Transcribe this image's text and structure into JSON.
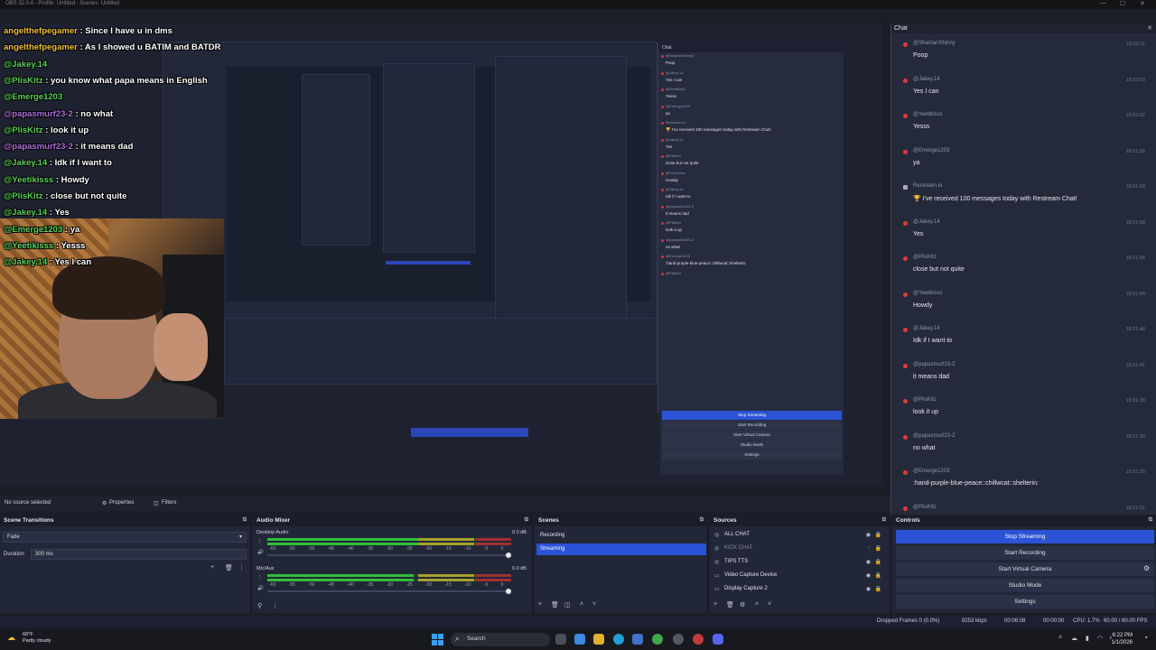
{
  "titlebar": {
    "title": "OBS 32.0.4 - Profile: Untitled - Scenes: Untitled"
  },
  "overlay_chat": [
    {
      "name": "angelthefpegamer",
      "msg": " : Since I have u in dms",
      "color": "#f0c040"
    },
    {
      "name": "angelthefpegamer",
      "msg": " : As I showed u BATIM and BATDR",
      "color": "#f0c040"
    },
    {
      "name": "@Jakey.14",
      "msg": "",
      "color": "#5ad25a"
    },
    {
      "name": "@PlisKitz",
      "msg": " : you know what papa means in English",
      "color": "#5ad25a"
    },
    {
      "name": "@Emerge1203",
      "msg": "",
      "color": "#5ad25a"
    },
    {
      "name": "@papasmurf23-2",
      "msg": " : no what",
      "color": "#b070e0"
    },
    {
      "name": "@PlisKitz",
      "msg": " : look it up",
      "color": "#5ad25a"
    },
    {
      "name": "@papasmurf23-2",
      "msg": " : it means dad",
      "color": "#b070e0"
    },
    {
      "name": "@Jakey.14",
      "msg": " : Idk if I want to",
      "color": "#5ad25a"
    },
    {
      "name": "@Yeetikisss",
      "msg": " : Howdy",
      "color": "#5ad25a"
    },
    {
      "name": "@PlisKitz",
      "msg": " : close but not quite",
      "color": "#5ad25a"
    },
    {
      "name": "@Jakey.14",
      "msg": " : Yes",
      "color": "#5ad25a"
    },
    {
      "name": "@Emerge1203",
      "msg": " : ya",
      "color": "#5ad25a"
    },
    {
      "name": "@Yeetikisss",
      "msg": " : Yesss",
      "color": "#5ad25a"
    },
    {
      "name": "@Jakey.14",
      "msg": " : Yes I can",
      "color": "#5ad25a"
    }
  ],
  "chat": {
    "title": "Chat",
    "messages": [
      {
        "user": "@ShamanShinny",
        "time": "18:22:11",
        "text": "Poop",
        "bot": false
      },
      {
        "user": "@Jakey.14",
        "time": "18:22:03",
        "text": "Yes I can",
        "bot": false
      },
      {
        "user": "@Yeetikisss",
        "time": "18:22:02",
        "text": "Yesss",
        "bot": false
      },
      {
        "user": "@Emerge1203",
        "time": "18:21:59",
        "text": "ya",
        "bot": false
      },
      {
        "user": "Restream.io",
        "time": "18:21:58",
        "text": "🏆 I've received 100 messages today with Restream Chat!",
        "bot": true
      },
      {
        "user": "@Jakey.14",
        "time": "18:21:58",
        "text": "Yes",
        "bot": false
      },
      {
        "user": "@PlisKitz",
        "time": "18:21:58",
        "text": "close but not quite",
        "bot": false
      },
      {
        "user": "@Yeetikisss",
        "time": "18:21:54",
        "text": "Howdy",
        "bot": false
      },
      {
        "user": "@Jakey.14",
        "time": "18:21:48",
        "text": "Idk if I want to",
        "bot": false
      },
      {
        "user": "@papasmurf23-2",
        "time": "18:21:41",
        "text": "it means dad",
        "bot": false
      },
      {
        "user": "@PlisKitz",
        "time": "18:21:38",
        "text": "look it up",
        "bot": false
      },
      {
        "user": "@papasmurf23-2",
        "time": "18:21:30",
        "text": "no what",
        "bot": false
      },
      {
        "user": "@Emerge1203",
        "time": "18:21:25",
        "text": ":hand-purple-blue-peace::chillwcat::shelterin:",
        "bot": false
      },
      {
        "user": "@PlisKitz",
        "time": "18:21:21",
        "text": "",
        "bot": false
      }
    ]
  },
  "inner_chat": [
    {
      "user": "@ShamanShinny",
      "text": "Poop"
    },
    {
      "user": "@Jakey.14",
      "text": "Yes I can"
    },
    {
      "user": "@Yeetikisss",
      "text": "Yesss"
    },
    {
      "user": "@Emerge1203",
      "text": "ya"
    },
    {
      "user": "Restream.io",
      "text": "🏆 I've received 100 messages today with Restream Chat!"
    },
    {
      "user": "@Jakey.14",
      "text": "Yes"
    },
    {
      "user": "@PlisKitz",
      "text": "close but not quite"
    },
    {
      "user": "@Yeetikisss",
      "text": "Howdy"
    },
    {
      "user": "@Jakey.14",
      "text": "Idk if I want to"
    },
    {
      "user": "@papasmurf23-2",
      "text": "it means dad"
    },
    {
      "user": "@PlisKitz",
      "text": "look it up"
    },
    {
      "user": "@papasmurf23-2",
      "text": "no what"
    },
    {
      "user": "@Emerge1203",
      "text": ":hand-purple-blue-peace::chillwcat::shelterin:"
    },
    {
      "user": "@PlisKitz",
      "text": ""
    }
  ],
  "inner_controls": [
    "Stop Streaming",
    "Start Recording",
    "Start Virtual Camera",
    "Studio Mode",
    "Settings"
  ],
  "status_strip": {
    "source": "No source selected",
    "properties": "Properties",
    "filters": "Filters"
  },
  "transitions": {
    "title": "Scene Transitions",
    "selected": "Fade",
    "duration_label": "Duration",
    "duration_value": "300 ms"
  },
  "mixer": {
    "title": "Audio Mixer",
    "tracks": [
      {
        "name": "Desktop Audio",
        "db": "0.0 dB",
        "level": 0.74
      },
      {
        "name": "Mic/Aux",
        "db": "0.0 dB",
        "level": 0.6
      }
    ],
    "ticks": "-60 -55 -50 -45 -40 -35 -30 -25 -20 -15 -10 -5 0"
  },
  "scenes": {
    "title": "Scenes",
    "items": [
      {
        "name": "Recording",
        "active": false
      },
      {
        "name": "Streaming",
        "active": true
      }
    ]
  },
  "sources": {
    "title": "Sources",
    "items": [
      {
        "name": "ALL CHAT",
        "dim": false
      },
      {
        "name": "KICK CHAT",
        "dim": true
      },
      {
        "name": "TIPS TTS",
        "dim": false
      },
      {
        "name": "Video Capture Device",
        "dim": false
      },
      {
        "name": "Display Capture 2",
        "dim": false
      }
    ]
  },
  "controls": {
    "title": "Controls",
    "items": [
      {
        "label": "Stop Streaming",
        "on": true
      },
      {
        "label": "Start Recording",
        "on": false
      },
      {
        "label": "Start Virtual Camera",
        "on": false
      },
      {
        "label": "Studio Mode",
        "on": false
      },
      {
        "label": "Settings",
        "on": false
      }
    ]
  },
  "statusbar": {
    "dropped": "Dropped Frames 0 (0.0%)",
    "kbps": "8253 kbps",
    "stream_time": "00:06:08",
    "rec_time": "00:00:00",
    "cpu": "CPU: 1.7%",
    "fps": "60.00 / 60.00 FPS"
  },
  "taskbar": {
    "weather_temp": "60°F",
    "weather_desc": "Partly cloudy",
    "search": "Search",
    "time": "6:22 PM",
    "date": "1/1/2026"
  },
  "colors": {
    "accent": "#2c52d6",
    "chat_icon": "#e03a3a"
  }
}
